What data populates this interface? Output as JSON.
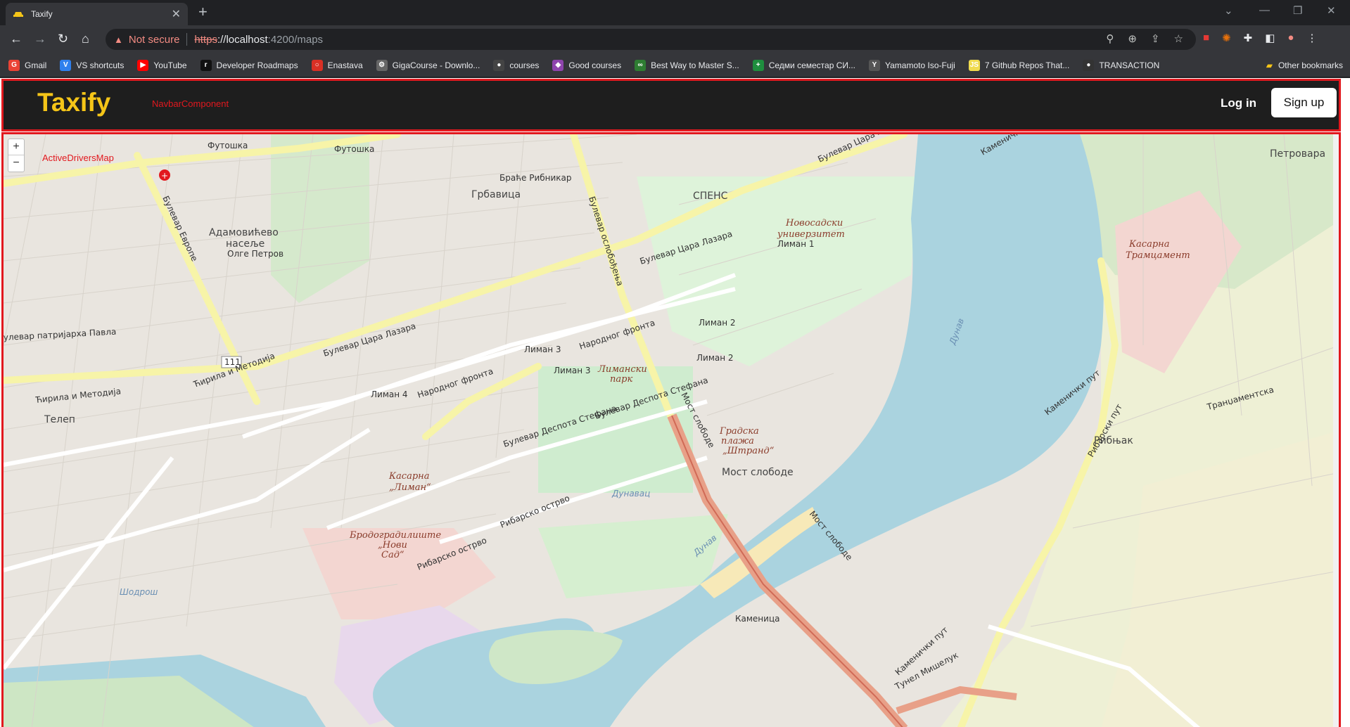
{
  "browser": {
    "tab_title": "Taxify",
    "url_scheme": "https",
    "url_host": "://localhost",
    "url_path": ":4200/maps",
    "security_text": "Not secure",
    "bookmarks": [
      {
        "label": "Gmail",
        "icon": "G",
        "color": "#ea4335"
      },
      {
        "label": "VS shortcuts",
        "icon": "V",
        "color": "#2f80ed"
      },
      {
        "label": "YouTube",
        "icon": "▶",
        "color": "#ff0000"
      },
      {
        "label": "Developer Roadmaps",
        "icon": "r",
        "color": "#111111"
      },
      {
        "label": "Enastava",
        "icon": "○",
        "color": "#d93025"
      },
      {
        "label": "GigaCourse - Downlo...",
        "icon": "⚙",
        "color": "#666666"
      },
      {
        "label": "courses",
        "icon": "●",
        "color": "#444444"
      },
      {
        "label": "Good courses",
        "icon": "◆",
        "color": "#8e44ad"
      },
      {
        "label": "Best Way to Master S...",
        "icon": "∞",
        "color": "#2e7d32"
      },
      {
        "label": "Седми семестар СИ...",
        "icon": "+",
        "color": "#1e8e3e"
      },
      {
        "label": "Yamamoto Iso-Fuji",
        "icon": "Y",
        "color": "#555555"
      },
      {
        "label": "7 Github Repos That...",
        "icon": "JS",
        "color": "#f0db4f"
      },
      {
        "label": "TRANSACTION",
        "icon": "●",
        "color": "#333333"
      }
    ],
    "other_bookmarks": "Other bookmarks"
  },
  "navbar": {
    "brand": "Taxify",
    "component_tag": "NavbarComponent",
    "login_label": "Log in",
    "signup_label": "Sign up"
  },
  "map": {
    "component_tag": "ActiveDriversMap",
    "zoom_in": "+",
    "zoom_out": "−",
    "labels": {
      "futoshka1": "Футошка",
      "futoshka2": "Футошка",
      "grbavica": "Грбавица",
      "spens": "СПЕНС",
      "adamovicevo": "Адамовићево",
      "naselje": "насеље",
      "olge_petrov": "Олге Петров",
      "bulevar_evrope": "Булевар Европе",
      "bulevar_oslobodjenja": "Булевар ослобођења",
      "bulevar_cara_lazara1": "Булевар Цара Лазара",
      "bulevar_cara_lazara2": "Булевар Цара Лазара",
      "bulevar_cara_lazara3": "Булевар Цара Лазара",
      "bulevar_patrijarha": "улевар патријарха Павла",
      "novosadski": "Новосадски",
      "univerzitet": "универзитет",
      "liman1": "Лиман 1",
      "liman2a": "Лиман 2",
      "liman2b": "Лиман 2",
      "liman3a": "Лиман 3",
      "liman3b": "Лиман 3",
      "liman4": "Лиман 4",
      "limanski": "Лимански",
      "park": "парк",
      "narodnog_fronta1": "Народног фронта",
      "narodnog_fronta2": "Народног фронта",
      "most_slobode1": "Мост слободе",
      "most_slobode2": "Мост слободе",
      "most_slobode3": "Мост слободе",
      "gradska_plaza": "Градска",
      "plaza2": "плажа",
      "strand": "„Штранд“",
      "dunav1": "Дунав",
      "dunav2": "Дунав",
      "dunavac": "Дунавац",
      "kasarna_liman1": "Касарна",
      "kasarna_liman2": "„Лиман“",
      "kasarna_tranc1": "Касарна",
      "kasarna_tranc2": "Трамцамент",
      "brodogradiliste1": "Бродоградилиште",
      "brodogradiliste2": "„Нови",
      "brodogradiliste3": "Сад“",
      "ribarsko_ostrvo1": "Рибарско острво",
      "ribarsko_ostrvo2": "Рибарско острво",
      "telep": "Телеп",
      "kirila1": "Ћирила и Методија",
      "kirila2": "Ћирила и Методија",
      "ribnjak": "Рибњак",
      "kamenicki_put1": "Каменички пут",
      "kamenicki_put2": "Каменички пут",
      "kamenicki_put3": "Каменички пут",
      "tunel": "Тунел Мишелук",
      "petrovaradin": "Петровара",
      "sodros": "Шодрош",
      "route_111": "111",
      "bulevar_despota": "Булевар Деспота Стефана",
      "bulevar_despota2": "Булевар Деспота Стефана",
      "kamenica": "Каменица",
      "brace_ribnikar": "Браће Рибникар",
      "tranzamentska": "Транџаментска",
      "ribarski_put": "Рибарски пут"
    }
  }
}
